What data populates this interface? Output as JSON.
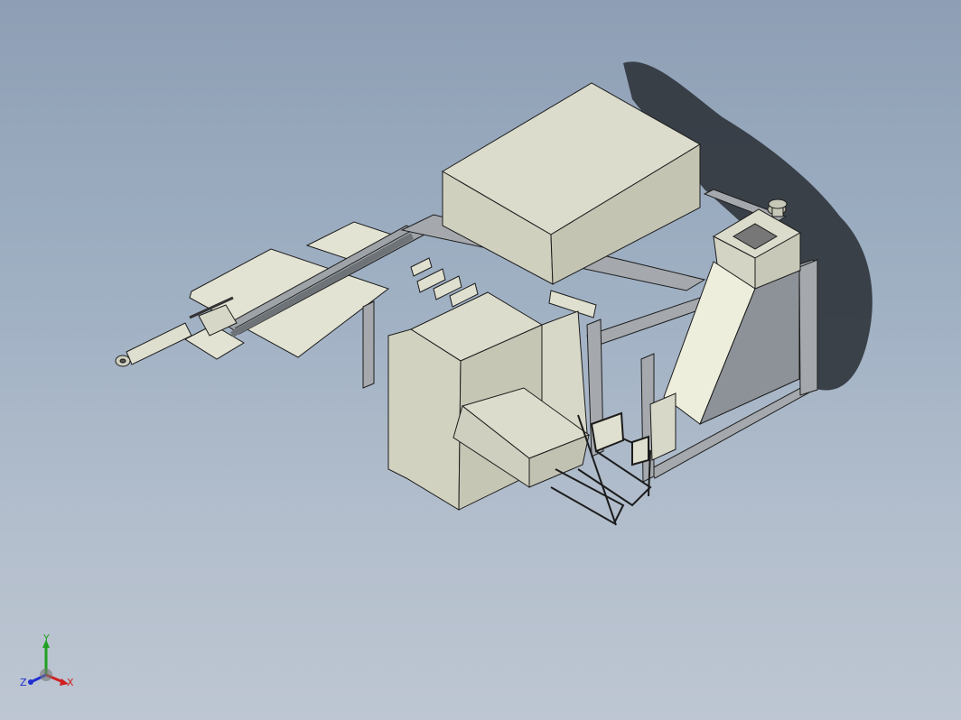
{
  "view": {
    "type": "isometric-cad-model",
    "background_top": "#8e9fb5",
    "background_bottom": "#bdc6d2",
    "part_color": "#e3e3d3",
    "frame_color": "#9ea3a8",
    "edge_color": "#1c1c1c",
    "shadow_color": "#2f343b"
  },
  "triad": {
    "x_label": "X",
    "y_label": "Y",
    "z_label": "Z",
    "x_color": "#d02020",
    "y_color": "#20a020",
    "z_color": "#2030d0"
  }
}
